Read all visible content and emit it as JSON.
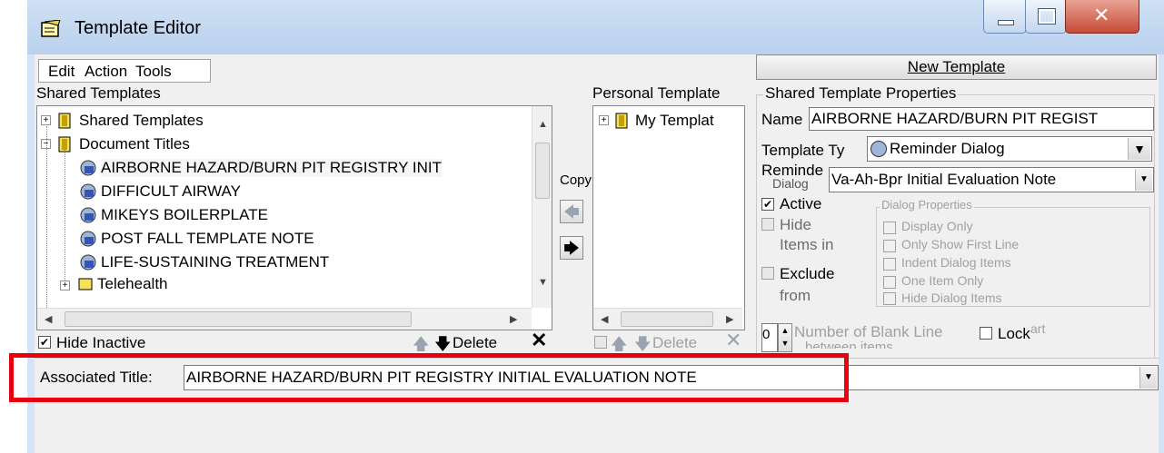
{
  "window": {
    "title": "Template Editor",
    "icon": "notepad-icon"
  },
  "menu": {
    "items": [
      "Edit",
      "Action",
      "Tools"
    ]
  },
  "shared": {
    "label": "Shared Templates",
    "tree": [
      {
        "label": "Shared Templates",
        "icon": "folder-icon",
        "expander": "+"
      },
      {
        "label": "Document Titles",
        "icon": "folder-icon",
        "expander": "-"
      },
      {
        "label": "AIRBORNE HAZARD/BURN PIT REGISTRY INIT",
        "icon": "reminder-dialog-icon"
      },
      {
        "label": "DIFFICULT AIRWAY",
        "icon": "reminder-dialog-icon"
      },
      {
        "label": "MIKEYS BOILERPLATE",
        "icon": "reminder-dialog-icon"
      },
      {
        "label": "POST FALL TEMPLATE NOTE",
        "icon": "reminder-dialog-icon"
      },
      {
        "label": "LIFE-SUSTAINING TREATMENT",
        "icon": "reminder-dialog-icon"
      },
      {
        "label": "Telehealth",
        "icon": "folder-icon",
        "expander": "+"
      }
    ],
    "hide_inactive_label": "Hide Inactive",
    "delete_label": "Delete"
  },
  "copy": {
    "label": "Copy"
  },
  "personal": {
    "label": "Personal Template",
    "tree": [
      {
        "label": "My Templat",
        "icon": "folder-icon",
        "expander": "+"
      }
    ],
    "delete_label": "Delete"
  },
  "properties": {
    "new_template_label": "New Template",
    "group_title": "Shared Template Properties",
    "name_label": "Name",
    "name_value": "AIRBORNE HAZARD/BURN PIT REGIST",
    "type_label": "Template Ty",
    "type_value": "Reminder Dialog",
    "reminder_label": "Reminde",
    "reminder_label2": "Dialog",
    "reminder_value": "Va-Ah-Bpr Initial Evaluation Note",
    "active_label": "Active",
    "hide_items_label1": "Hide",
    "hide_items_label2": "Items in",
    "exclude_label1": "Exclude",
    "exclude_label2": "from",
    "dialog_props_title": "Dialog Properties",
    "dialog_props": [
      "Display Only",
      "Only Show First Line",
      "Indent Dialog Items",
      "One Item Only",
      "Hide Dialog Items"
    ],
    "blank_lines_value": "0",
    "blank_lines_label": "Number of Blank Line",
    "blank_lines_label2": "between items",
    "lock_label": "Lock",
    "tart_label": "art"
  },
  "associated": {
    "label": "Associated Title:",
    "value": "AIRBORNE HAZARD/BURN PIT REGISTRY INITIAL EVALUATION NOTE"
  },
  "colors": {
    "highlight_box": "#e8000c",
    "window_frame": "#d4e3f5"
  }
}
